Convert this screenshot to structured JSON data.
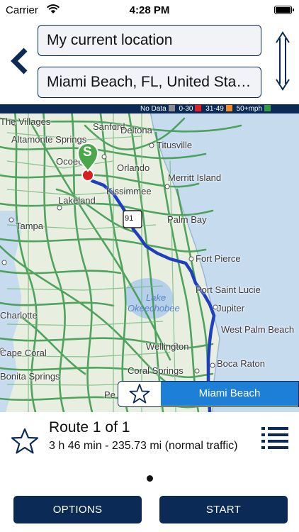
{
  "status_bar": {
    "carrier": "Carrier",
    "time": "4:28 PM"
  },
  "route_inputs": {
    "from": "My current location",
    "to": "Miami Beach, FL, United States"
  },
  "traffic_legend": {
    "items": [
      {
        "label": "No Data",
        "color": "#8c8c8c"
      },
      {
        "label": "0-30",
        "color": "#e02020"
      },
      {
        "label": "31-49",
        "color": "#f08a2a"
      },
      {
        "label": "50+mph",
        "color": "#2e9c46"
      }
    ]
  },
  "map": {
    "start_marker": "S",
    "highway_shield": "91",
    "cities": {
      "the_villages": "The Villages",
      "sanford": "Sanford",
      "deltona": "Deltona",
      "altamonte_springs": "Altamonte Springs",
      "titusville": "Titusville",
      "ocoee": "Ocoee",
      "orlando": "Orlando",
      "merritt_island": "Merritt Island",
      "kissimmee": "Kissimmee",
      "lakeland": "Lakeland",
      "palm_bay": "Palm Bay",
      "tampa": "Tampa",
      "fort_pierce": "Fort Pierce",
      "port_saint_lucie": "Port Saint Lucie",
      "lake": "Lake",
      "okeechobee": "Okeechobee",
      "jupiter": "Jupiter",
      "charlotte": "Charlotte",
      "west_palm_beach": "West Palm Beach",
      "wellington": "Wellington",
      "cape_coral": "Cape Coral",
      "boca_raton": "Boca Raton",
      "coral_springs": "Coral Springs",
      "bonita_springs": "Bonita Springs",
      "pe": "Pe"
    },
    "destination_label": "Miami Beach",
    "colors": {
      "route": "#1f3fbf",
      "traffic_fast": "#2e9c46",
      "ocean": "#c7dbef",
      "land": "#e8efe0"
    }
  },
  "route_info": {
    "title": "Route 1 of 1",
    "detail": "3 h 46 min - 235.73 mi (normal traffic)"
  },
  "buttons": {
    "options": "OPTIONS",
    "start": "START"
  },
  "colors": {
    "accent": "#0b2a55",
    "destination": "#1d7fd8"
  }
}
